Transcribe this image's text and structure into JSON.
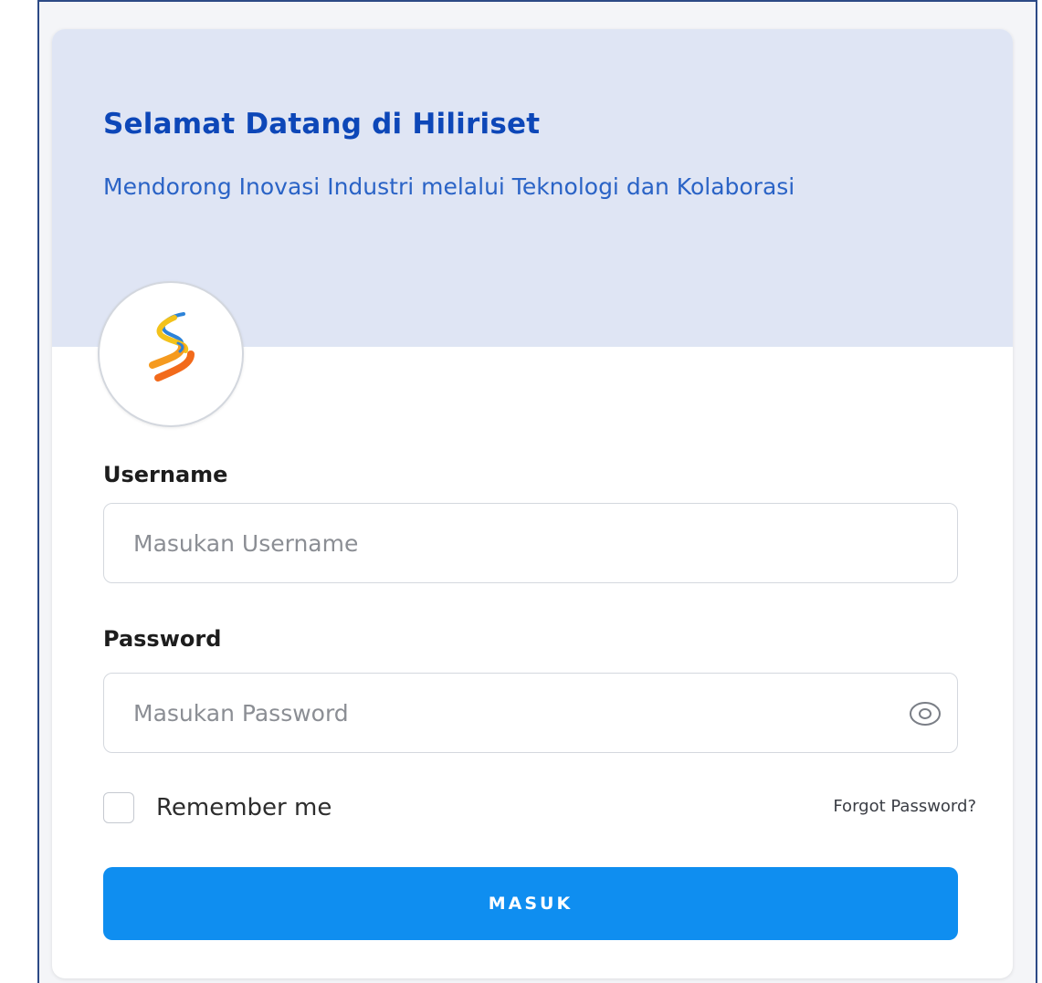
{
  "header": {
    "title": "Selamat Datang di Hiliriset",
    "subtitle": "Mendorong Inovasi Industri melalui Teknologi dan Kolaborasi"
  },
  "logo": {
    "icon": "hiliriset-logo-icon"
  },
  "form": {
    "username": {
      "label": "Username",
      "placeholder": "Masukan Username",
      "value": ""
    },
    "password": {
      "label": "Password",
      "placeholder": "Masukan Password",
      "value": "",
      "toggle_icon": "eye-icon"
    },
    "remember_label": "Remember me",
    "remember_checked": false,
    "forgot_label": "Forgot Password?",
    "submit_label": "MASUK"
  },
  "colors": {
    "brand": "#0d47b8",
    "accent": "#0f8ef0",
    "banner": "#dfe5f4"
  }
}
